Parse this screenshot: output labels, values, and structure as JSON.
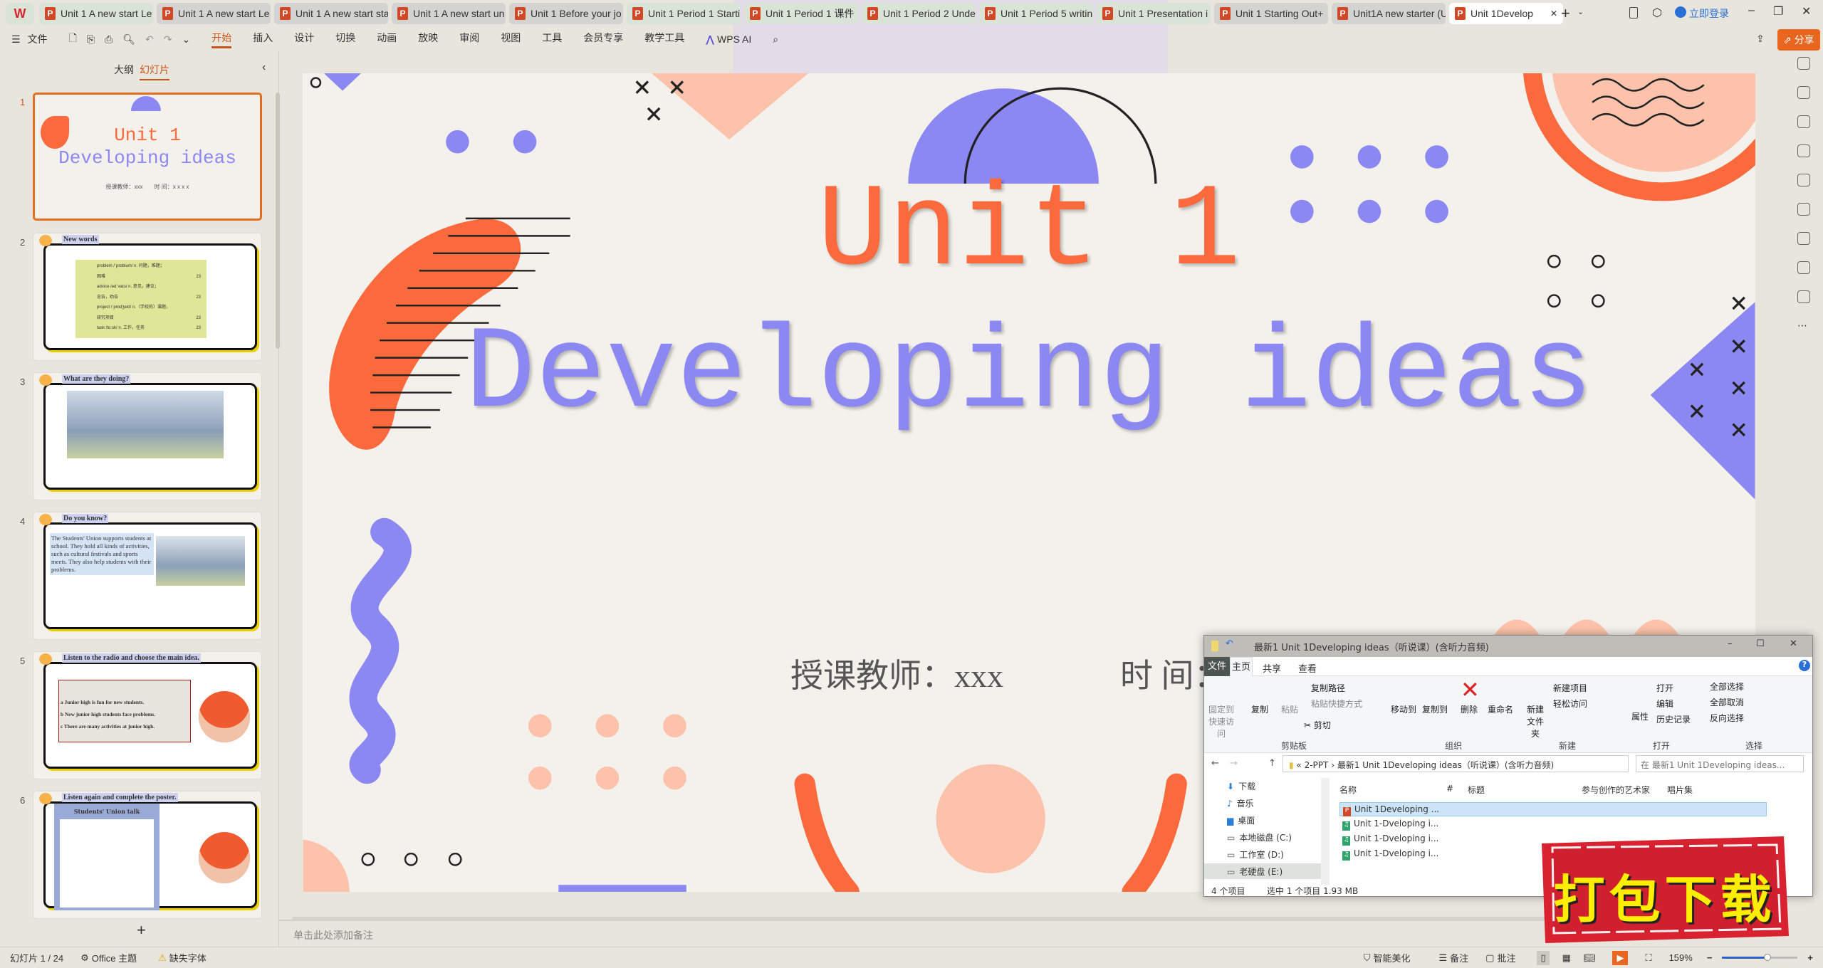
{
  "tabs": [
    {
      "label": "Unit 1 A new start Le",
      "style": "green"
    },
    {
      "label": "Unit 1 A new start Le",
      "style": "gray"
    },
    {
      "label": "Unit 1 A new start sta",
      "style": "gray"
    },
    {
      "label": "Unit 1 A new start un",
      "style": "gray"
    },
    {
      "label": "Unit 1 Before your jo",
      "style": "gray"
    },
    {
      "label": "Unit 1 Period 1 Starti",
      "style": "green"
    },
    {
      "label": "Unit 1 Period 1 课件",
      "style": "green"
    },
    {
      "label": "Unit 1 Period 2 Unde",
      "style": "green"
    },
    {
      "label": "Unit 1 Period 5 writin",
      "style": "green"
    },
    {
      "label": "Unit 1 Presentation i",
      "style": "green"
    },
    {
      "label": "Unit 1 Starting Out+",
      "style": "gray"
    },
    {
      "label": "Unit1A new starter (U",
      "style": "gray"
    },
    {
      "label": "Unit 1Develop",
      "style": "active"
    }
  ],
  "window": {
    "login": "立即登录",
    "share": "分享"
  },
  "toolbar": {
    "file": "文件",
    "menus": [
      "开始",
      "插入",
      "设计",
      "切换",
      "动画",
      "放映",
      "审阅",
      "视图",
      "工具",
      "会员专享",
      "教学工具"
    ],
    "active": "开始",
    "wps_ai": "WPS AI"
  },
  "leftpanel": {
    "tab_outline": "大纲",
    "tab_slides": "幻灯片",
    "add": "+"
  },
  "thumbs": {
    "s1": {
      "num": "1",
      "title1": "Unit 1",
      "title2": "Developing ideas",
      "sub": "授课教师：xxx　　时 间：x x x x"
    },
    "s2": {
      "num": "2",
      "head": "New words",
      "rows": [
        [
          "problem /ˈprɒbləm/ n. 问题，难题；",
          ""
        ],
        [
          "困难",
          "23"
        ],
        [
          "advice /ədˈvaɪs/ n. 意见，建议；",
          ""
        ],
        [
          "忠告，劝告",
          "23"
        ],
        [
          "project /ˈprɒdʒekt/ n.（学校的）课题，",
          ""
        ],
        [
          "研究项目",
          "23"
        ],
        [
          "task /tɑːsk/ n. 工作，任务",
          "23"
        ]
      ]
    },
    "s3": {
      "num": "3",
      "head": "What are they doing?"
    },
    "s4": {
      "num": "4",
      "head": "Do you know?",
      "text": "The Students' Union supports students at school. They hold all kinds of activities, such as cultural festivals and sports meets. They also help students with their problems."
    },
    "s5": {
      "num": "5",
      "head": "Listen to the radio and choose the main idea.",
      "options": [
        "a Junior high is fun for new students.",
        "b New junior high students face problems.",
        "c There are many activities at junior high."
      ]
    },
    "s6": {
      "num": "6",
      "head": "Listen again and complete the poster.",
      "poster": "Students' Union talk"
    }
  },
  "slide": {
    "title1": "Unit 1",
    "title2": "Developing ideas",
    "teacher": "授课教师：xxx",
    "time": "时 间：x x x x",
    "colors": {
      "orange": "#fa6a3c",
      "blue": "#8c88f2",
      "peach": "#fcc2ab",
      "bg": "#f4f1ec"
    }
  },
  "notes": {
    "placeholder": "单击此处添加备注"
  },
  "status": {
    "slide": "幻灯片 1 / 24",
    "theme": "Office 主题",
    "missing_font": "缺失字体",
    "beautify": "智能美化",
    "notes": "备注",
    "comments": "批注",
    "zoom": "159%",
    "zoom_level": 0.6
  },
  "explorer": {
    "title": "最新1 Unit 1Developing ideas（听说课）(含听力音频)",
    "tabs": [
      "文件",
      "主页",
      "共享",
      "查看"
    ],
    "ribbon": {
      "pin": "固定到快速访问",
      "copy": "复制",
      "paste": "粘贴",
      "copy_path": "复制路径",
      "paste_shortcut": "粘贴快捷方式",
      "cut": "剪切",
      "move_to": "移动到",
      "copy_to": "复制到",
      "delete": "删除",
      "rename": "重命名",
      "new_folder": "新建文件夹",
      "new_item": "新建项目",
      "easy_access": "轻松访问",
      "properties": "属性",
      "open": "打开",
      "edit": "编辑",
      "history": "历史记录",
      "select_all": "全部选择",
      "select_none": "全部取消",
      "invert": "反向选择"
    },
    "groups": [
      "剪贴板",
      "组织",
      "新建",
      "打开",
      "选择"
    ],
    "path": [
      "2-PPT",
      "最新1 Unit 1Developing ideas（听说课）(含听力音频)"
    ],
    "search_placeholder": "在 最新1 Unit 1Developing ideas...",
    "nav": [
      "下载",
      "音乐",
      "桌面",
      "本地磁盘 (C:)",
      "工作室 (D:)",
      "老硬盘 (E:)"
    ],
    "columns": [
      "名称",
      "#",
      "标题",
      "参与创作的艺术家",
      "唱片集"
    ],
    "files": [
      {
        "name": "Unit 1Developing ...",
        "type": "ppt",
        "selected": true
      },
      {
        "name": "Unit 1-Dveloping i...",
        "type": "audio"
      },
      {
        "name": "Unit 1-Dveloping i...",
        "type": "audio"
      },
      {
        "name": "Unit 1-Dveloping i...",
        "type": "audio"
      }
    ],
    "status_count": "4 个项目",
    "status_sel": "选中 1 个项目  1.93 MB"
  },
  "stamp": {
    "text": "打包下载"
  }
}
